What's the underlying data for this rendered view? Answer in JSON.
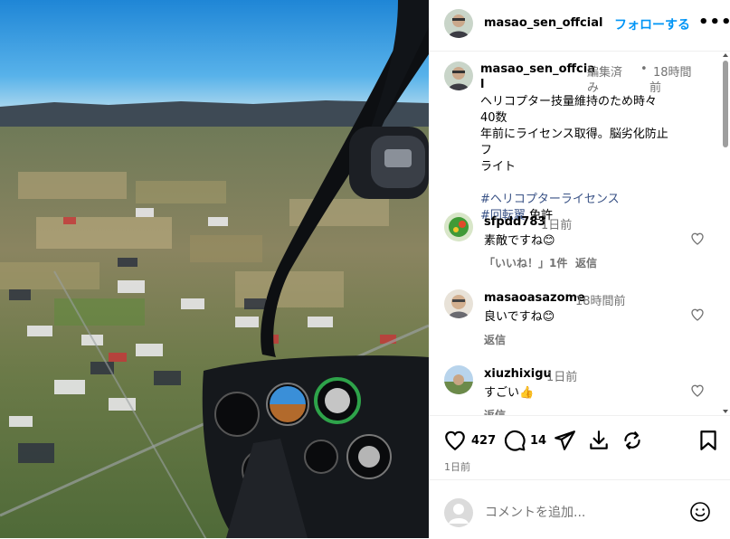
{
  "post": {
    "username": "masao_sen_offcial",
    "follow_label": "フォローする",
    "more_label": "•••"
  },
  "caption": {
    "username_line1": "masao_sen_offcia",
    "username_line2": "l",
    "edited_line1": "編集済",
    "edited_line2": "み",
    "dot": "•",
    "time_line1": "18時間",
    "time_line2": "前",
    "text_line1": "ヘリコプター技量維持のため時々40数",
    "text_line2": "年前にライセンス取得。脳劣化防止フ",
    "text_line3": "ライト",
    "hashtag1": "#ヘリコプターライセンス",
    "hashtag2": "#回転翼",
    "hashtag2_suffix": " 免許"
  },
  "comments": [
    {
      "username": "sfpdd783",
      "time": "1日前",
      "text": "素敵ですね😊",
      "likes": "「いいね！」1件",
      "reply": "返信"
    },
    {
      "username": "masaoasazome",
      "time": "18時間前",
      "text": "良いですね😊",
      "reply": "返信"
    },
    {
      "username": "xiuzhixigu",
      "time": "1日前",
      "text": "すごい👍",
      "reply": "返信"
    }
  ],
  "actions": {
    "like_count": "427",
    "comment_count": "14",
    "date": "1日前"
  },
  "add_comment": {
    "placeholder": "コメントを追加..."
  },
  "colors": {
    "link": "#0095f6",
    "hashtag": "#385185",
    "muted": "#737373"
  }
}
